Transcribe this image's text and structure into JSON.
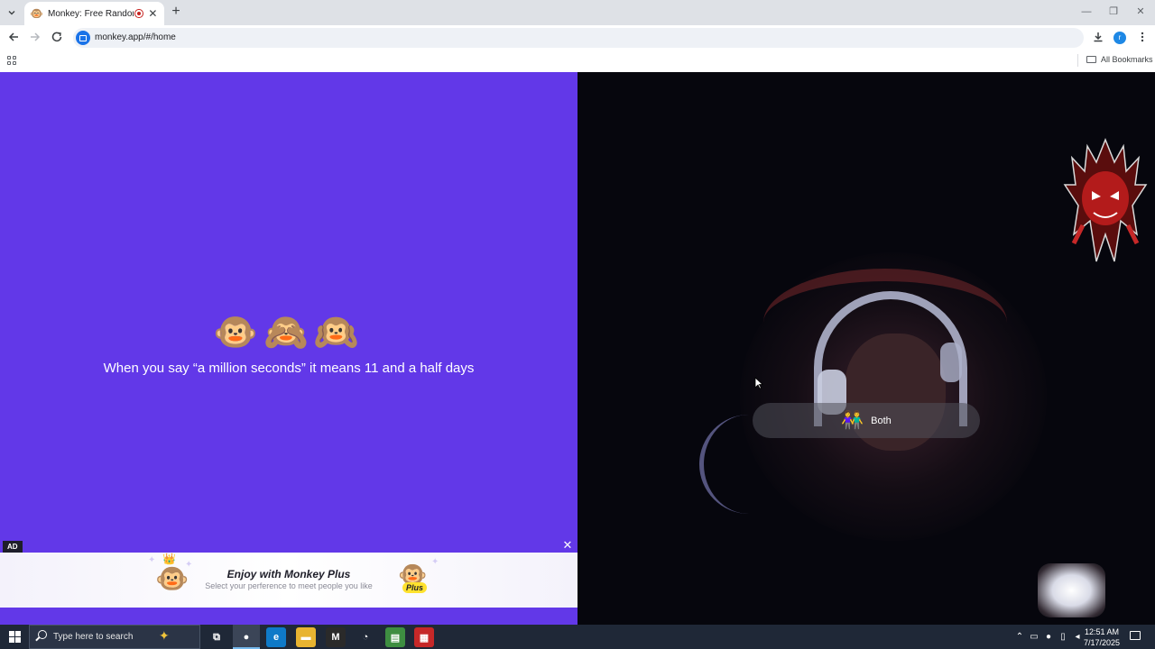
{
  "browser": {
    "tab": {
      "title": "Monkey: Free Random Vide",
      "favicon": "🐵",
      "close": "✕"
    },
    "new_tab": "+",
    "window_controls": {
      "minimize": "—",
      "maximize": "❐",
      "close": "✕"
    },
    "url": "monkey.app/#/home",
    "profile_initial": "r",
    "bookmarks_label": "All Bookmarks"
  },
  "left_panel": {
    "emojis": "🐵🙈🙉",
    "fact": "When you say “a million seconds” it means 11 and a half days",
    "background": "#6238e8"
  },
  "ad": {
    "label": "AD",
    "close": "✕",
    "title": "Enjoy with Monkey Plus",
    "subtitle": "Select your perference to meet people you like",
    "badge": "Plus"
  },
  "video": {
    "preference_icon": "👫",
    "preference_label": "Both"
  },
  "taskbar": {
    "search_placeholder": "Type here to search",
    "clock_time": "12:51 AM",
    "clock_date": "7/17/2025",
    "apps": [
      {
        "name": "task-view",
        "glyph": "⧉",
        "color": "#1f2837"
      },
      {
        "name": "chrome",
        "glyph": "●",
        "color": "#3b4557"
      },
      {
        "name": "edge",
        "glyph": "e",
        "color": "#0f7ac8"
      },
      {
        "name": "file-explorer",
        "glyph": "▬",
        "color": "#e8b431"
      },
      {
        "name": "app-m",
        "glyph": "M",
        "color": "#2a2a2a"
      },
      {
        "name": "app-speedometer",
        "glyph": "◔",
        "color": "#1f2837"
      },
      {
        "name": "app-editor",
        "glyph": "▤",
        "color": "#3e8e41"
      },
      {
        "name": "app-video-writer",
        "glyph": "▦",
        "color": "#c62828"
      }
    ]
  },
  "colors": {
    "accent_purple": "#6238e8",
    "taskbar": "#1f2837",
    "record_red": "#c5221f",
    "plus_yellow": "#ffe22e"
  }
}
